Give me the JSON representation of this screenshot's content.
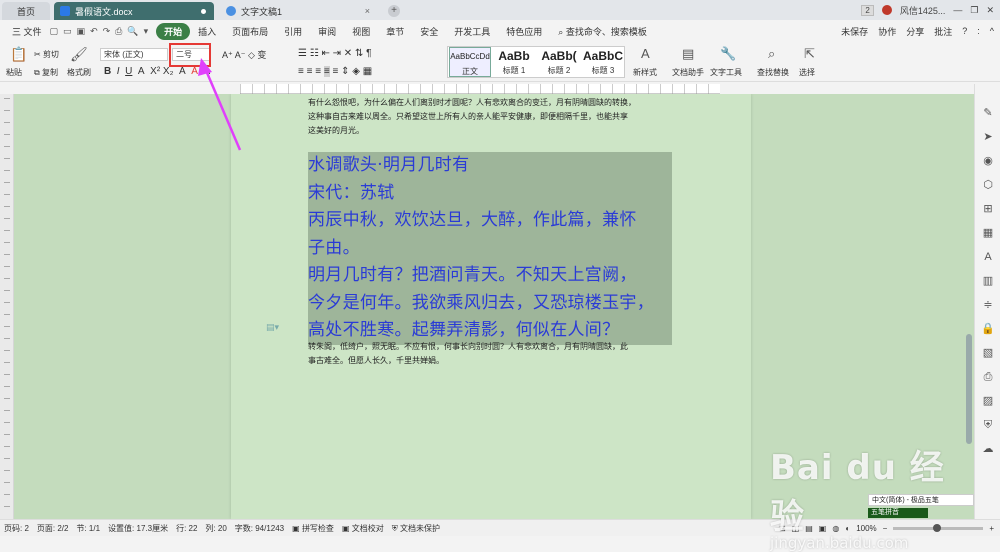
{
  "titlebar": {
    "home_tab": "首页",
    "doc_tab": "暑假语文.docx",
    "doc2_tab": "文字文稿1",
    "badge": "2",
    "user": "风信1425...",
    "close_glyph": "×"
  },
  "menubar": {
    "file": "三 文件",
    "items": [
      "开始",
      "插入",
      "页面布局",
      "引用",
      "审阅",
      "视图",
      "章节",
      "安全",
      "开发工具",
      "特色应用"
    ],
    "search": "查找命令、搜索模板",
    "right": [
      "未保存",
      "协作",
      "分享",
      "批注"
    ]
  },
  "ribbon": {
    "paste": "粘贴",
    "cut": "剪切",
    "copy": "复制",
    "format_painter": "格式刷",
    "font_name": "宋体 (正文)",
    "font_size": "二号",
    "styles": [
      {
        "sample": "AaBbCcDd",
        "name": "正文"
      },
      {
        "sample": "AaBb",
        "name": "标题 1"
      },
      {
        "sample": "AaBb(",
        "name": "标题 2"
      },
      {
        "sample": "AaBbC",
        "name": "标题 3"
      }
    ],
    "new_style": "新样式",
    "text_assistant": "文档助手",
    "text_tools": "文字工具",
    "find_replace": "查找替换",
    "select": "选择"
  },
  "document": {
    "top_lines": [
      "有什么怨恨吧，为什么偏在人们离别时才圆呢？人有悲欢离合的变迁，月有阴晴圆缺的转换，",
      "这种事自古来难以周全。只希望这世上所有人的亲人能平安健康，即便相隔千里，也能共享",
      "这美好的月光。"
    ],
    "selected_lines": [
      "水调歌头·明月几时有",
      "宋代：苏轼",
      "丙辰中秋，欢饮达旦，大醉，作此篇，兼怀",
      "子由。",
      "明月几时有？把酒问青天。不知天上宫阙，",
      "今夕是何年。我欲乘风归去，又恐琼楼玉宇，",
      "高处不胜寒。起舞弄清影，何似在人间？"
    ],
    "bottom_lines": [
      "转朱阁，低绮户，照无眠。不应有恨，何事长向别时圆？人有悲欢离合，月有阴晴圆缺，此",
      "事古难全。但愿人长久，千里共婵娟。"
    ]
  },
  "status": {
    "page": "页码: 2",
    "pages": "页面: 2/2",
    "section": "节: 1/1",
    "setting": "设置值: 17.3厘米",
    "row": "行: 22",
    "col": "列: 20",
    "words": "字数: 94/1243",
    "spell": "拼写检查",
    "doc_check": "文档校对",
    "protect": "文档未保护",
    "zoom": "100%"
  },
  "ime": {
    "line1": "中文(简体) - 极品五笔",
    "line2": "五笔拼音"
  },
  "watermark": {
    "big": "Bai du 经验",
    "small": "jingyan.baidu.com"
  },
  "colors": {
    "accent": "#3b7f46",
    "page_bg": "#cde5c6",
    "selection": "#9eb59a",
    "selected_text": "#2a3bd6",
    "highlight_box": "#e53935",
    "arrow": "#e040fb"
  }
}
